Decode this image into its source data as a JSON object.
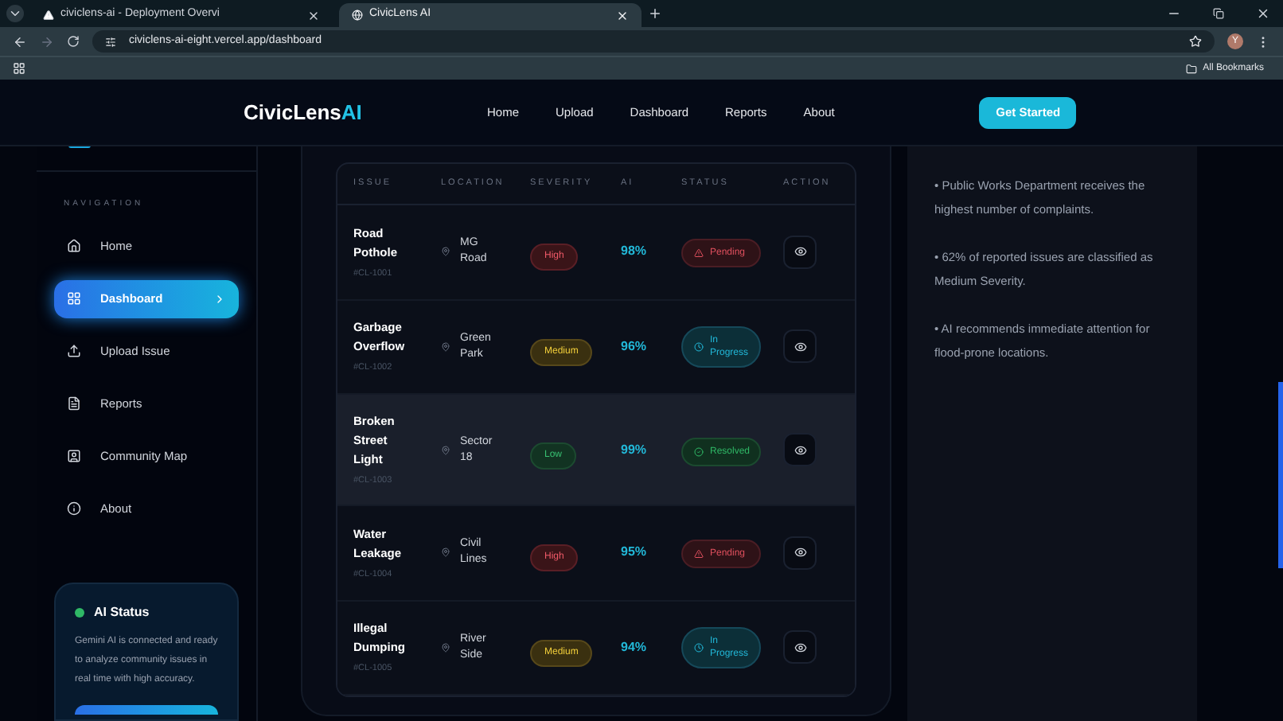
{
  "browser": {
    "tabs": [
      {
        "title": "civiclens-ai - Deployment Overvi",
        "selected": false
      },
      {
        "title": "CivicLens AI",
        "selected": true
      }
    ],
    "url": "civiclens-ai-eight.vercel.app/dashboard",
    "profile": "Y",
    "bookmarks_folder": "All Bookmarks"
  },
  "navbar": {
    "logo_main": "CivicLens",
    "logo_accent": "AI",
    "links": [
      "Home",
      "Upload",
      "Dashboard",
      "Reports",
      "About"
    ],
    "cta": "Get Started"
  },
  "sidebar": {
    "heading": "NAVIGATION",
    "items": [
      {
        "label": "Home",
        "kind": "home",
        "selected": false
      },
      {
        "label": "Dashboard",
        "kind": "dashboard",
        "selected": true
      },
      {
        "label": "Upload Issue",
        "kind": "upload",
        "selected": false
      },
      {
        "label": "Reports",
        "kind": "reports",
        "selected": false
      },
      {
        "label": "Community Map",
        "kind": "map",
        "selected": false
      },
      {
        "label": "About",
        "kind": "about",
        "selected": false
      }
    ],
    "ai_status": {
      "title": "AI Status",
      "online": true,
      "text": "Gemini AI is connected and ready to analyze community issues in real time with high accuracy."
    }
  },
  "table": {
    "columns": [
      "ISSUE",
      "LOCATION",
      "SEVERITY",
      "AI",
      "STATUS",
      "ACTION"
    ],
    "rows": [
      {
        "issue": "Road Pothole",
        "id": "#CL-1001",
        "location": "MG Road",
        "severity": {
          "text": "High",
          "kind": "high"
        },
        "ai": "98%",
        "status": {
          "text": "Pending",
          "kind": "pending"
        },
        "hovered": false
      },
      {
        "issue": "Garbage Overflow",
        "id": "#CL-1002",
        "location": "Green Park",
        "severity": {
          "text": "Medium",
          "kind": "medium"
        },
        "ai": "96%",
        "status": {
          "text": "In Progress",
          "kind": "progress"
        },
        "hovered": false
      },
      {
        "issue": "Broken Street Light",
        "id": "#CL-1003",
        "location": "Sector 18",
        "severity": {
          "text": "Low",
          "kind": "low"
        },
        "ai": "99%",
        "status": {
          "text": "Resolved",
          "kind": "resolved"
        },
        "hovered": true
      },
      {
        "issue": "Water Leakage",
        "id": "#CL-1004",
        "location": "Civil Lines",
        "severity": {
          "text": "High",
          "kind": "high"
        },
        "ai": "95%",
        "status": {
          "text": "Pending",
          "kind": "pending"
        },
        "hovered": false
      },
      {
        "issue": "Illegal Dumping",
        "id": "#CL-1005",
        "location": "River Side",
        "severity": {
          "text": "Medium",
          "kind": "medium"
        },
        "ai": "94%",
        "status": {
          "text": "In Progress",
          "kind": "progress"
        },
        "hovered": false
      }
    ]
  },
  "insights": [
    "• Public Works Department receives the highest number of complaints.",
    "• 62% of reported issues are classified as Medium Severity.",
    "• AI recommends immediate attention for flood-prone locations."
  ]
}
